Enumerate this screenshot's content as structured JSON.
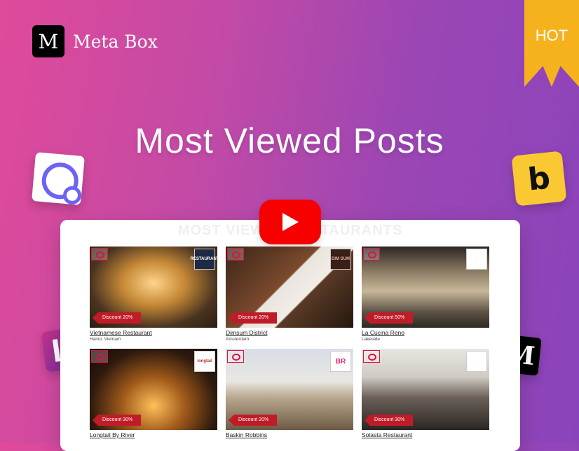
{
  "brand": {
    "mark": "M",
    "name": "Meta Box"
  },
  "badge": {
    "label": "HOT"
  },
  "headline": "Most Viewed Posts",
  "card": {
    "title": "MOST VIEWED RESTAURANTS",
    "items": [
      {
        "name": "Vietnamese Restaurant",
        "location": "Hanoi, Vietnam",
        "discount": "Discount 20%",
        "logo_text": "RESTAURANT"
      },
      {
        "name": "Dimsum District",
        "location": "Amsterdam",
        "discount": "Discount 20%",
        "logo_text": "DIM SUM"
      },
      {
        "name": "La Cucina Reno",
        "location": "Lakeside",
        "discount": "Discount 50%",
        "logo_text": ""
      },
      {
        "name": "Longtail By River",
        "location": "",
        "discount": "Discount 30%",
        "logo_text": "longtail"
      },
      {
        "name": "Baskin Robbins",
        "location": "",
        "discount": "Discount 20%",
        "logo_text": "BR"
      },
      {
        "name": "Solasta Restaurant",
        "location": "",
        "discount": "Discount 30%",
        "logo_text": ""
      }
    ]
  },
  "logos": {
    "b_letter": "b",
    "m_letter": "M"
  },
  "icons": [
    "eye-icon",
    "youtube-play-icon",
    "elementor-logo-icon",
    "oxygen-logo-icon",
    "beaver-builder-logo-icon",
    "meta-box-logo-icon"
  ]
}
